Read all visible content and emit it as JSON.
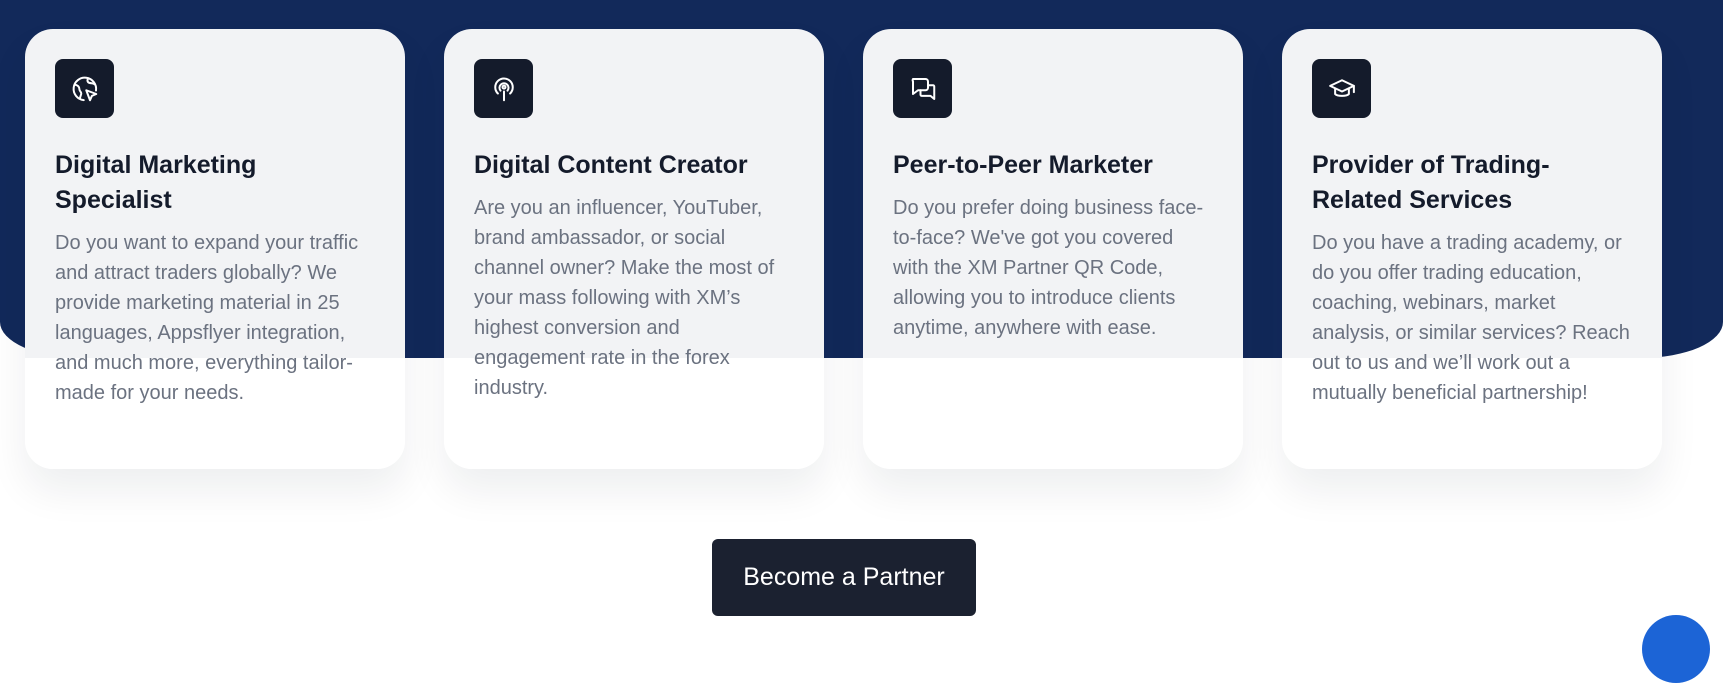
{
  "cards": [
    {
      "icon": "globe-cursor-icon",
      "title": "Digital Marketing Specialist",
      "text": "Do you want to expand your traffic and attract traders globally? We provide marketing material in 25 languages, Appsflyer integration, and much more, everything tailor-made for your needs."
    },
    {
      "icon": "broadcast-icon",
      "title": "Digital Content Creator",
      "text": "Are you an influencer, YouTuber, brand ambassador, or social channel owner? Make the most of your mass following with XM’s highest conversion and engagement rate in the forex industry."
    },
    {
      "icon": "chat-bubbles-icon",
      "title": "Peer-to-Peer Marketer",
      "text": "Do you prefer doing business face-to-face? We've got you covered with the XM Partner QR Code, allowing you to introduce clients anytime, anywhere with ease."
    },
    {
      "icon": "graduation-cap-icon",
      "title": "Provider of Trading-Related Services",
      "text": "Do you have a trading academy, or do you offer trading education, coaching, webinars, market analysis, or similar services? Reach out to us and we’ll work out a mutually beneficial partnership!"
    }
  ],
  "cta": {
    "label": "Become a Partner"
  },
  "colors": {
    "navy_background": "#12295a",
    "card_background": "#f2f3f5",
    "icon_background": "#141b2b",
    "button_background": "#1b2130",
    "chat_bubble": "#1c64d6"
  }
}
